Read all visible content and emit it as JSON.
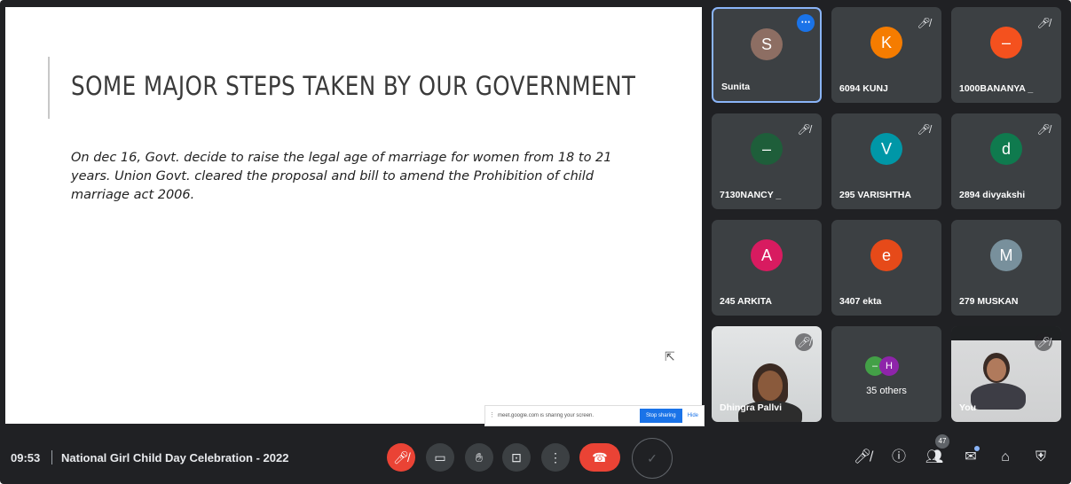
{
  "slide": {
    "title": "SOME MAJOR STEPS TAKEN BY OUR GOVERNMENT",
    "body": "On dec 16, Govt. decide to raise the legal age of marriage for women from 18 to 21 years. Union Govt. cleared the proposal and bill to amend the Prohibition of child marriage act 2006."
  },
  "share_bar": {
    "text": "meet.google.com is sharing your screen.",
    "stop_label": "Stop sharing",
    "hide_label": "Hide"
  },
  "participants": [
    {
      "name": "Sunita",
      "initial": "S",
      "color": "#8d6e63",
      "pinned_menu": true
    },
    {
      "name": "6094 KUNJ",
      "initial": "K",
      "color": "#f57c00"
    },
    {
      "name": "1000BANANYA _",
      "initial": "–",
      "color": "#f4511e"
    },
    {
      "name": "7130NANCY _",
      "initial": "–",
      "color": "#1e5e3a"
    },
    {
      "name": "295 VARISHTHA",
      "initial": "V",
      "color": "#0097a7"
    },
    {
      "name": "2894 divyakshi",
      "initial": "d",
      "color": "#0f7a4e"
    },
    {
      "name": "245 ARKITA",
      "initial": "A",
      "color": "#d81b60"
    },
    {
      "name": "3407 ekta",
      "initial": "e",
      "color": "#e64a19"
    },
    {
      "name": "279 MUSKAN",
      "initial": "M",
      "color": "#78909c"
    },
    {
      "name": "Dhingra Pallvi",
      "video": true
    },
    {
      "others_label": "35 others",
      "mini": [
        {
          "initial": "–",
          "color": "#43a047"
        },
        {
          "initial": "H",
          "color": "#8e24aa"
        }
      ]
    },
    {
      "name": "You",
      "video": true
    }
  ],
  "bottom_bar": {
    "time": "09:53",
    "meeting_title": "National Girl Child Day Celebration - 2022",
    "participant_count": "47"
  },
  "icons": {
    "mic_off": "mic-off-icon",
    "camera": "camera-icon",
    "hand": "raise-hand-icon",
    "present": "present-icon",
    "more": "more-options-icon",
    "end_call": "end-call-icon"
  }
}
